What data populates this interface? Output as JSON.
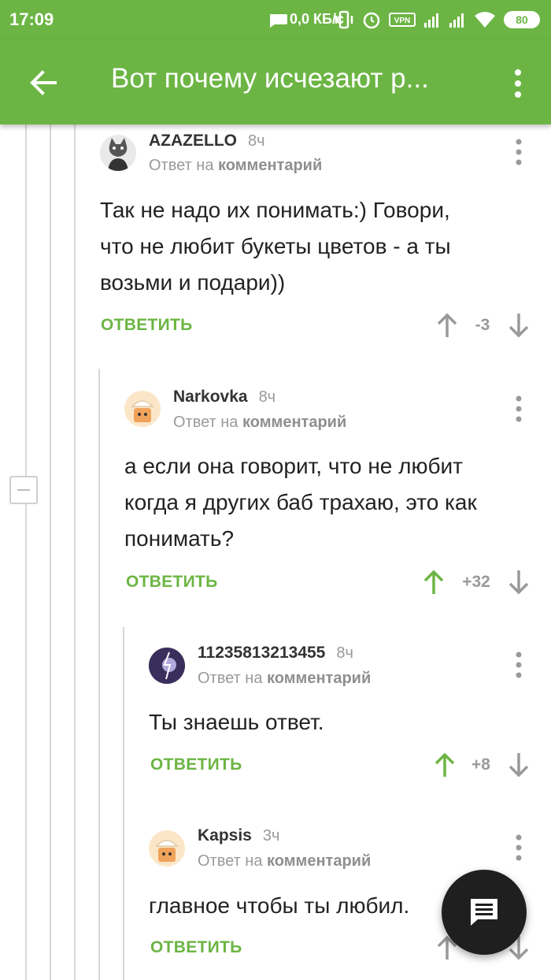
{
  "status_bar": {
    "time": "17:09",
    "net_speed": "0,0 КБ/с",
    "battery": "80"
  },
  "app_bar": {
    "title": "Вот почему исчезают р..."
  },
  "comments": [
    {
      "author": "AZAZELLO",
      "time": "8ч",
      "reply_prefix": "Ответ на",
      "reply_link": "комментарий",
      "text_lines": [
        "Так не надо их понимать:) Говори,",
        "что не любит букеты цветов - а ты",
        "возьми и подари))"
      ],
      "reply_label": "ОТВЕТИТЬ",
      "score": "-3"
    },
    {
      "author": "Narkovka",
      "time": "8ч",
      "reply_prefix": "Ответ на",
      "reply_link": "комментарий",
      "text_lines": [
        "а если она говорит, что не любит",
        "когда я других баб трахаю, это как",
        "понимать?"
      ],
      "reply_label": "ОТВЕТИТЬ",
      "score": "+32"
    },
    {
      "author": "11235813213455",
      "time": "8ч",
      "reply_prefix": "Ответ на",
      "reply_link": "комментарий",
      "text_lines": [
        "Ты знаешь ответ."
      ],
      "reply_label": "ОТВЕТИТЬ",
      "score": "+8"
    },
    {
      "author": "Kapsis",
      "time": "3ч",
      "reply_prefix": "Ответ на",
      "reply_link": "комментарий",
      "text_lines": [
        "главное чтобы ты любил."
      ],
      "reply_label": "ОТВЕТИТЬ",
      "score": ""
    }
  ],
  "colors": {
    "accent": "#6cb544",
    "upvoted": "#6cb544",
    "neutral": "#9a9a9a"
  }
}
